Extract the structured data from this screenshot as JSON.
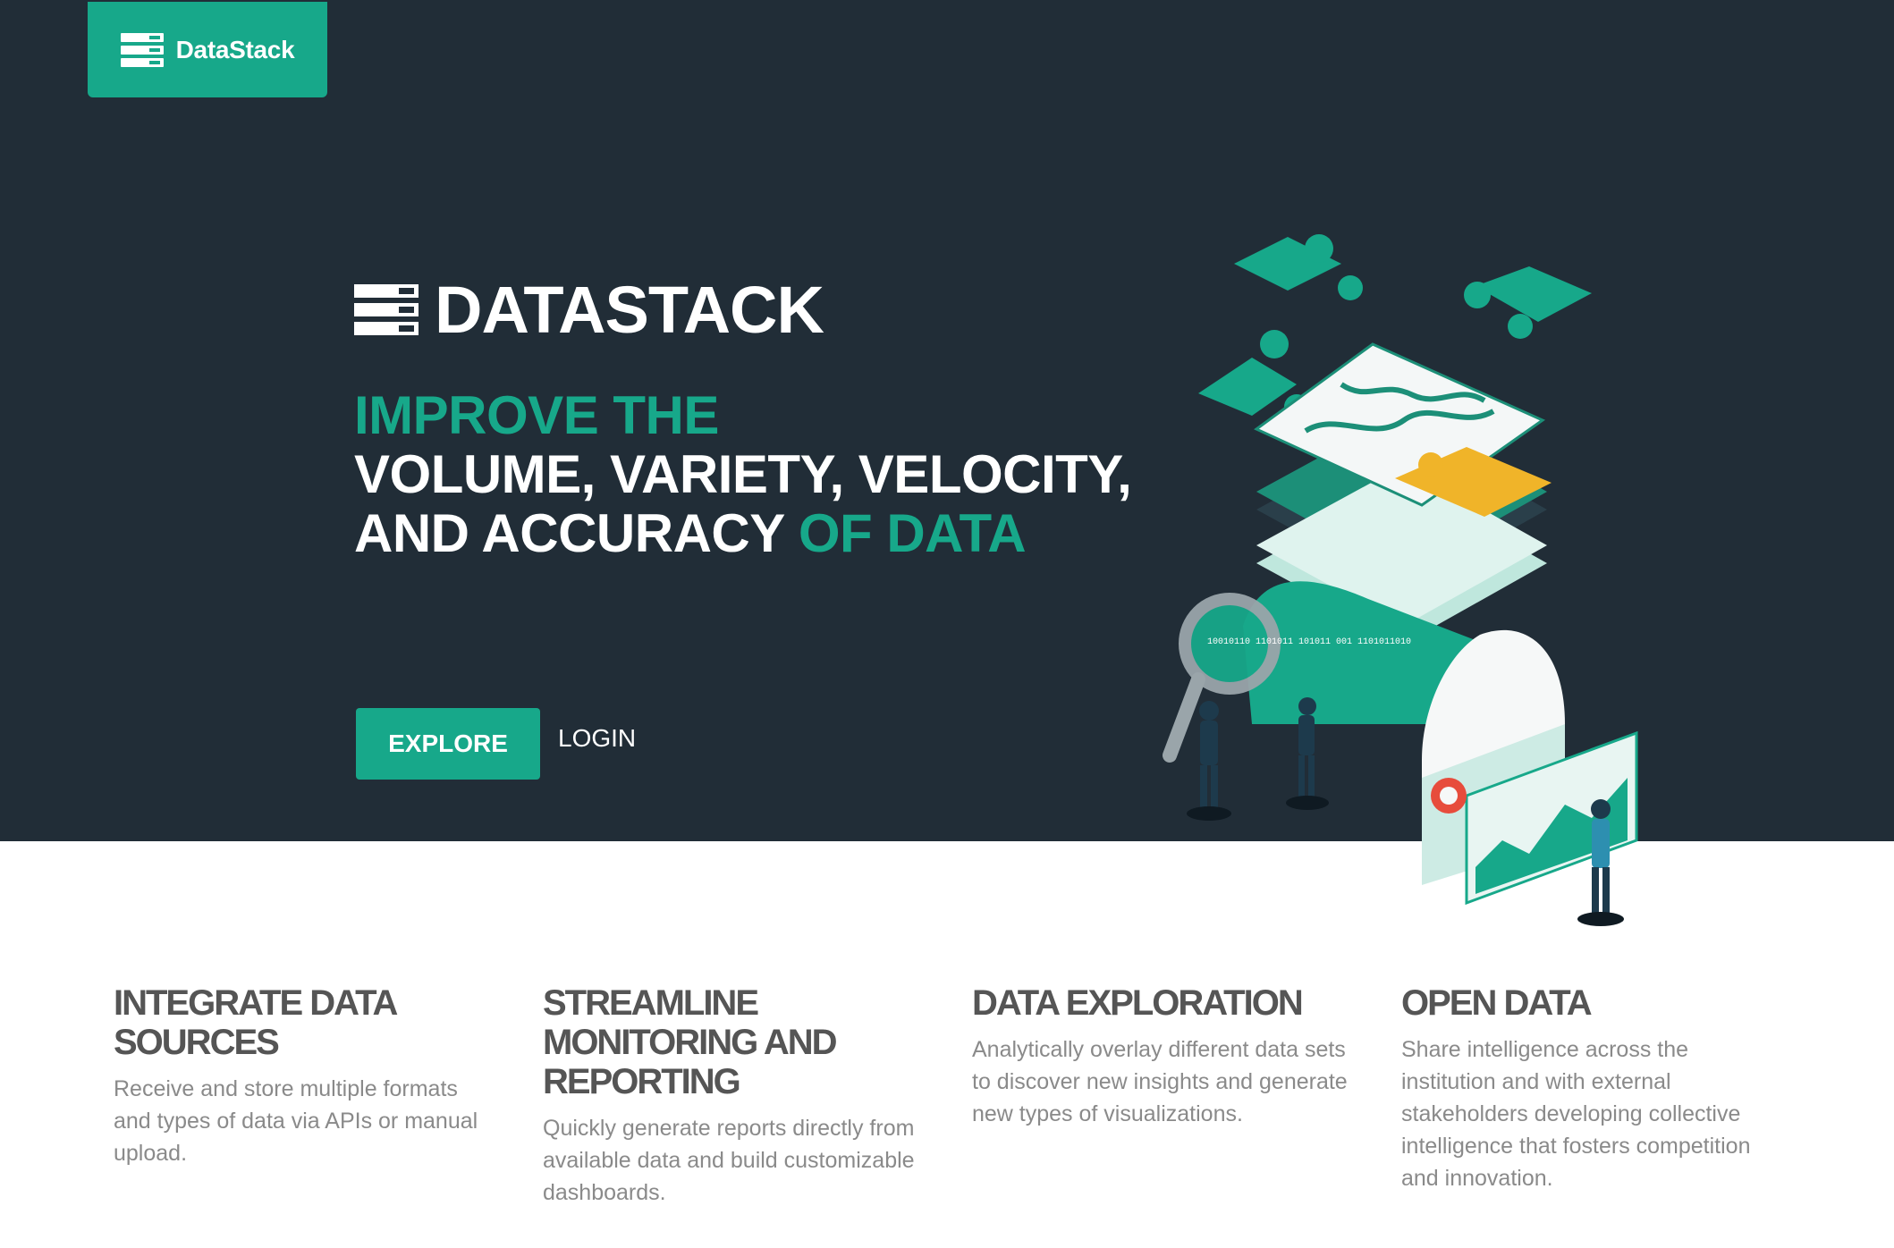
{
  "brand": {
    "name": "DataStack",
    "wordmark": "DATASTACK",
    "accent_color": "#17a88a",
    "dark_bg": "#212d37"
  },
  "hero": {
    "headline_line1": "IMPROVE THE",
    "headline_line2": "VOLUME, VARIETY, VELOCITY,",
    "headline_line3_main": "AND ACCURACY",
    "headline_line3_accent": "OF DATA",
    "explore_label": "EXPLORE",
    "login_label": "LOGIN",
    "illustration_text": "10010110 1101011 101011 001 1101011010"
  },
  "features": [
    {
      "title_lines": [
        "INTEGRATE DATA",
        "SOURCES"
      ],
      "description": "Receive and store multiple formats and types of data via APIs or manual upload."
    },
    {
      "title_lines": [
        "STREAMLINE",
        "MONITORING AND",
        "REPORTING"
      ],
      "description": "Quickly generate reports directly from available data and build customizable dashboards."
    },
    {
      "title_lines": [
        "DATA EXPLORATION"
      ],
      "description": "Analytically overlay different data sets to discover new insights and generate new types of visualizations."
    },
    {
      "title_lines": [
        "OPEN DATA"
      ],
      "description": "Share intelligence across the institution and with external stakeholders developing collective intelligence that fosters competition and innovation."
    }
  ]
}
